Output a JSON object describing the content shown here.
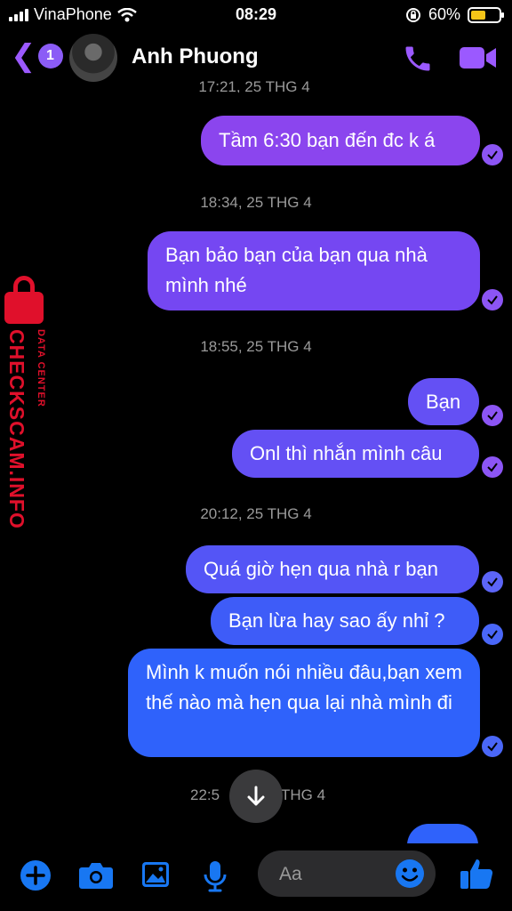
{
  "status_bar": {
    "carrier": "VinaPhone",
    "time": "08:29",
    "battery_percent": "60%",
    "battery_level": 0.6,
    "battery_color": "#f5c518"
  },
  "header": {
    "back_badge_count": "1",
    "contact_name": "Anh Phuong",
    "icons": [
      "chevron-left-icon",
      "phone-icon",
      "video-camera-icon"
    ],
    "accent_color": "#9b59ff"
  },
  "thread": {
    "partial_timestamp": "17:21, 25 THG 4",
    "groups": [
      {
        "messages": [
          {
            "text": "Tầm 6:30 bạn đến đc k á"
          }
        ]
      },
      {
        "timestamp": "18:34, 25 THG 4",
        "messages": [
          {
            "text": "Bạn bảo bạn của bạn qua nhà mình nhé"
          }
        ]
      },
      {
        "timestamp": "18:55, 25 THG 4",
        "messages": [
          {
            "text": "Bạn"
          },
          {
            "text": "Onl thì nhắn mình câu"
          }
        ]
      },
      {
        "timestamp": "20:12, 25 THG 4",
        "messages": [
          {
            "text": "Quá giờ hẹn qua nhà r bạn"
          },
          {
            "text": "Bạn lừa hay sao ấy nhỉ ?"
          },
          {
            "text": "Mình k muốn nói nhiều đâu,bạn xem thế nào mà hẹn qua lại nhà mình đi"
          }
        ]
      }
    ],
    "last_timestamp_left": "22:5",
    "last_timestamp_right": "THG 4"
  },
  "watermark": {
    "word": "CHECKSCAM.INFO",
    "sub": "DATA CENTER",
    "color": "#e0102b"
  },
  "composer": {
    "placeholder": "Aa"
  },
  "bottom_bar": {
    "icons": [
      "plus-circle-icon",
      "camera-icon",
      "image-icon",
      "microphone-icon",
      "emoji-icon",
      "thumbs-up-icon"
    ],
    "icon_color": "#1877f2"
  }
}
